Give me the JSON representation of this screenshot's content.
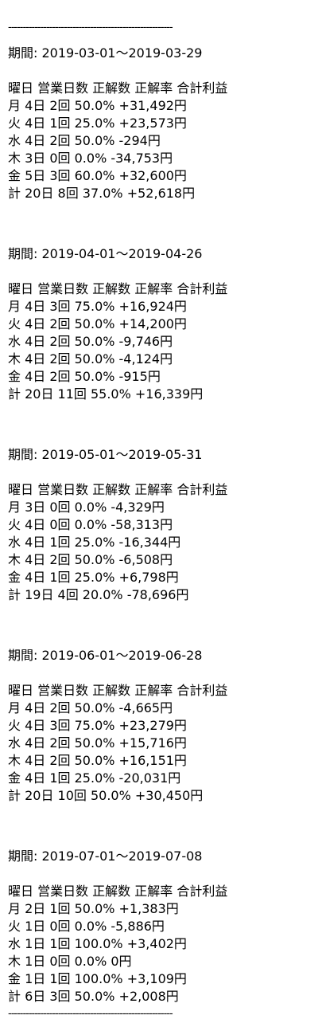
{
  "divider_top": "--------------------------------------------------------",
  "divider_bottom": "--------------------------------------------------------",
  "sections": [
    {
      "period": "期間: 2019-03-01〜2019-03-29",
      "header": "曜日 営業日数 正解数 正解率 合計利益",
      "rows": [
        "月 4日 2回 50.0% +31,492円",
        "火 4日 1回 25.0% +23,573円",
        "水 4日 2回 50.0% -294円",
        "木 3日 0回 0.0% -34,753円",
        "金 5日 3回 60.0% +32,600円",
        "計 20日 8回 37.0% +52,618円"
      ]
    },
    {
      "period": "期間: 2019-04-01〜2019-04-26",
      "header": "曜日 営業日数 正解数 正解率 合計利益",
      "rows": [
        "月 4日 3回 75.0% +16,924円",
        "火 4日 2回 50.0% +14,200円",
        "水 4日 2回 50.0% -9,746円",
        "木 4日 2回 50.0% -4,124円",
        "金 4日 2回 50.0% -915円",
        "計 20日 11回 55.0% +16,339円"
      ]
    },
    {
      "period": "期間: 2019-05-01〜2019-05-31",
      "header": "曜日 営業日数 正解数 正解率 合計利益",
      "rows": [
        "月 3日 0回 0.0% -4,329円",
        "火 4日 0回 0.0% -58,313円",
        "水 4日 1回 25.0% -16,344円",
        "木 4日 2回 50.0% -6,508円",
        "金 4日 1回 25.0% +6,798円",
        "計 19日 4回 20.0% -78,696円"
      ]
    },
    {
      "period": "期間: 2019-06-01〜2019-06-28",
      "header": "曜日 営業日数 正解数 正解率 合計利益",
      "rows": [
        "月 4日 2回 50.0% -4,665円",
        "火 4日 3回 75.0% +23,279円",
        "水 4日 2回 50.0% +15,716円",
        "木 4日 2回 50.0% +16,151円",
        "金 4日 1回 25.0% -20,031円",
        "計 20日 10回 50.0% +30,450円"
      ]
    },
    {
      "period": "期間: 2019-07-01〜2019-07-08",
      "header": "曜日 営業日数 正解数 正解率 合計利益",
      "rows": [
        "月 2日 1回 50.0% +1,383円",
        "火 1日 0回 0.0% -5,886円",
        "水 1日 1回 100.0% +3,402円",
        "木 1日 0回 0.0% 0円",
        "金 1日 1回 100.0% +3,109円",
        "計 6日 3回 50.0% +2,008円"
      ]
    }
  ]
}
